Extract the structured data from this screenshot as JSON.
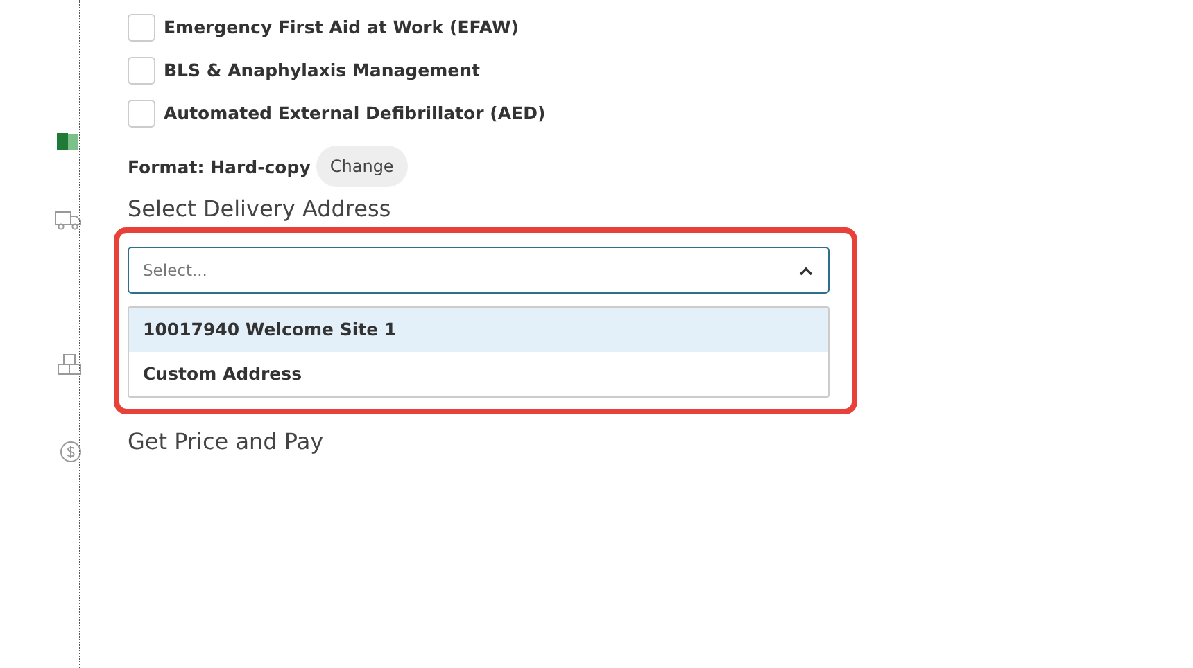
{
  "courses": [
    {
      "label": "Emergency First Aid at Work (EFAW)",
      "checked": false
    },
    {
      "label": "BLS & Anaphylaxis Management",
      "checked": false
    },
    {
      "label": "Automated External Defibrillator (AED)",
      "checked": false
    }
  ],
  "format": {
    "label": "Format: Hard-copy",
    "button": "Change"
  },
  "delivery": {
    "heading": "Select Delivery Address",
    "placeholder": "Select...",
    "expanded": true,
    "options": [
      {
        "label": "10017940 Welcome Site 1",
        "selected": true
      },
      {
        "label": "Custom Address",
        "selected": false
      }
    ]
  },
  "next_step": "Get Price and Pay"
}
